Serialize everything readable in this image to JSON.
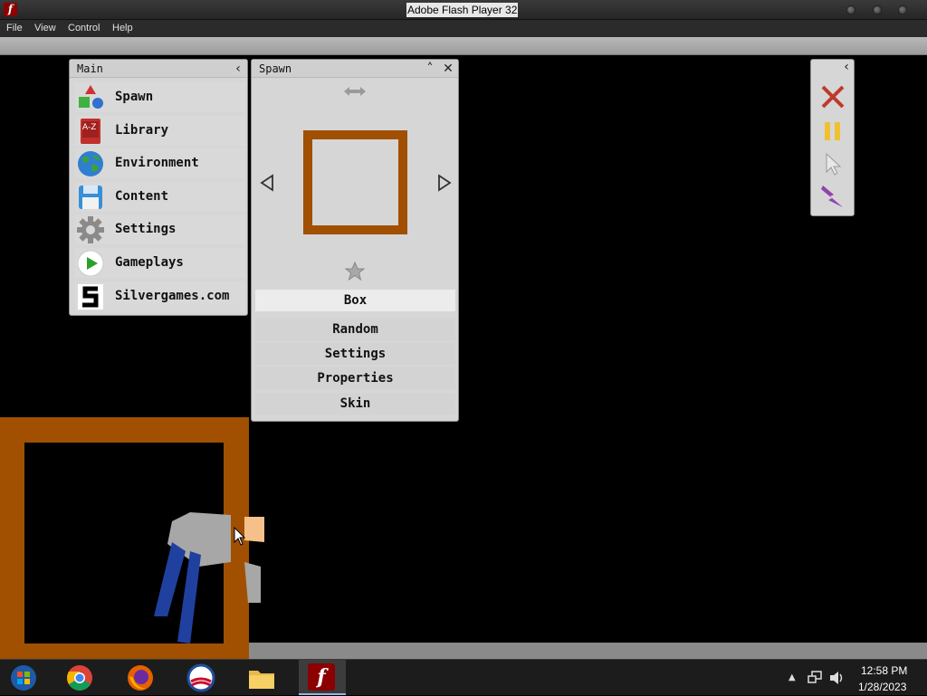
{
  "window": {
    "title": "Adobe Flash Player 32"
  },
  "menubar": {
    "file": "File",
    "view": "View",
    "control": "Control",
    "help": "Help"
  },
  "main_panel": {
    "title": "Main",
    "items": [
      {
        "label": "Spawn",
        "icon": "shapes-icon"
      },
      {
        "label": "Library",
        "icon": "book-icon"
      },
      {
        "label": "Environment",
        "icon": "globe-icon"
      },
      {
        "label": "Content",
        "icon": "floppy-disk-icon"
      },
      {
        "label": "Settings",
        "icon": "gear-icon"
      },
      {
        "label": "Gameplays",
        "icon": "play-icon"
      },
      {
        "label": "Silvergames.com",
        "icon": "silvergames-logo-icon"
      }
    ]
  },
  "library_icon_text": "A-Z",
  "spawn_panel": {
    "title": "Spawn",
    "selected": "Box",
    "options": [
      "Random",
      "Settings",
      "Properties",
      "Skin"
    ]
  },
  "colors": {
    "box_brown": "#a05000",
    "panel_bg": "#d6d6d6",
    "close_red": "#c0392b",
    "pause_yellow": "#f0c030",
    "lightning_purple": "#8e44ad"
  },
  "taskbar": {
    "time": "12:58 PM",
    "date": "1/28/2023"
  }
}
